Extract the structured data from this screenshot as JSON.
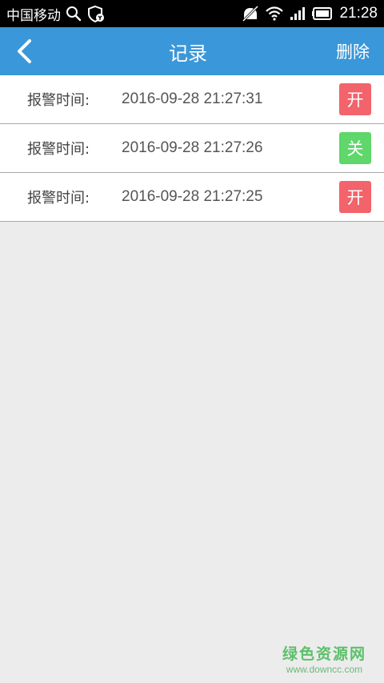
{
  "status_bar": {
    "carrier": "中国移动",
    "time": "21:28",
    "icons": [
      "search-icon",
      "shield-icon",
      "mute-icon",
      "wifi-icon",
      "signal-icon",
      "battery-icon"
    ]
  },
  "header": {
    "back_icon": "chevron-left-icon",
    "title": "记录",
    "delete_label": "删除"
  },
  "records": [
    {
      "label": "报警时间:",
      "time": "2016-09-28 21:27:31",
      "state": "开",
      "color": "#f2636b"
    },
    {
      "label": "报警时间:",
      "time": "2016-09-28 21:27:26",
      "state": "关",
      "color": "#5fd76a"
    },
    {
      "label": "报警时间:",
      "time": "2016-09-28 21:27:25",
      "state": "开",
      "color": "#f2636b"
    }
  ],
  "watermark": {
    "main": "绿色资源网",
    "sub": "www.downcc.com"
  },
  "colors": {
    "header_bg": "#3a97d9",
    "page_bg": "#ececec",
    "on": "#f2636b",
    "off": "#5fd76a"
  }
}
